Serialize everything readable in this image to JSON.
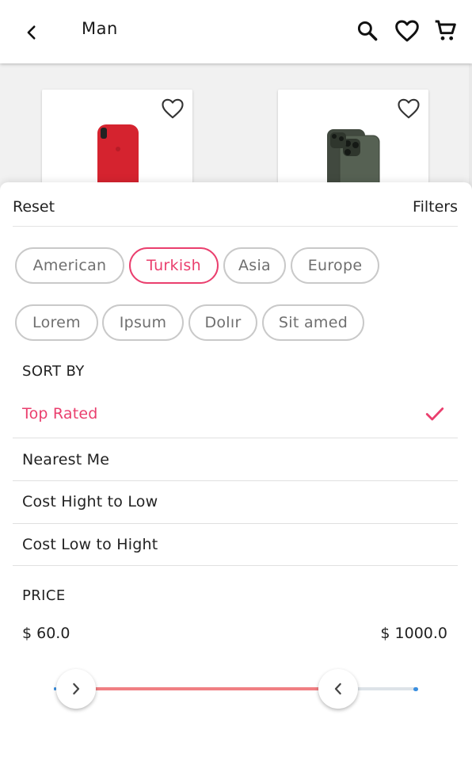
{
  "header": {
    "title": "Man",
    "icons": [
      "back-arrow-icon",
      "search-icon",
      "heart-icon",
      "cart-icon"
    ]
  },
  "products": [
    {
      "image": "red-phone-case",
      "favorite_icon": "heart-outline-icon"
    },
    {
      "image": "green-iphone-11-pro",
      "favorite_icon": "heart-outline-icon"
    }
  ],
  "sheet": {
    "reset_label": "Reset",
    "filters_label": "Filters"
  },
  "chips": [
    {
      "label": "American",
      "active": false
    },
    {
      "label": "Turkish",
      "active": true
    },
    {
      "label": "Asia",
      "active": false
    },
    {
      "label": "Europe",
      "active": false
    },
    {
      "label": "Lorem",
      "active": false
    },
    {
      "label": "Ipsum",
      "active": false
    },
    {
      "label": "Dolır",
      "active": false
    },
    {
      "label": "Sit amed",
      "active": false
    }
  ],
  "sort": {
    "title": "SORT BY",
    "options": [
      {
        "label": "Top Rated",
        "selected": true
      },
      {
        "label": "Nearest Me",
        "selected": false
      },
      {
        "label": "Cost Hight to Low",
        "selected": false
      },
      {
        "label": "Cost Low to Hight",
        "selected": false
      }
    ]
  },
  "price": {
    "title": "PRICE",
    "min_label": "$ 60.0",
    "max_label": "$ 1000.0",
    "range_start_fraction": 0.06,
    "range_end_fraction": 0.78
  },
  "colors": {
    "accent": "#ea3f6e",
    "slider_fill": "#f07f83",
    "slider_track": "#dde3e8",
    "slider_end": "#3a8fe0"
  }
}
